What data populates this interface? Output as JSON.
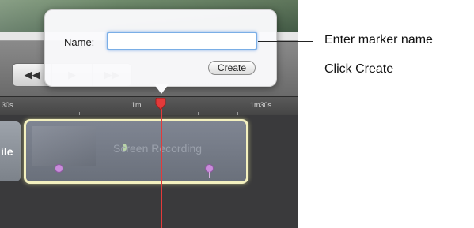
{
  "popover": {
    "name_label": "Name:",
    "name_value": "",
    "create_label": "Create"
  },
  "transport": {
    "rewind_icon": "◀◀",
    "play_icon": "▶",
    "fast_forward_icon": "▶▶"
  },
  "ruler": {
    "ticks": [
      "30s",
      "1m",
      "1m30s"
    ]
  },
  "timeline": {
    "track_header_label": "ile",
    "clip_label": "Screen Recording"
  },
  "callouts": {
    "enter_marker_name": "Enter marker name",
    "click_create": "Click Create"
  },
  "colors": {
    "playhead": "#e33a3a",
    "clip_border": "#f3f0bf",
    "focus_ring": "#7aaee6",
    "marker_pin": "#c98cdb"
  }
}
